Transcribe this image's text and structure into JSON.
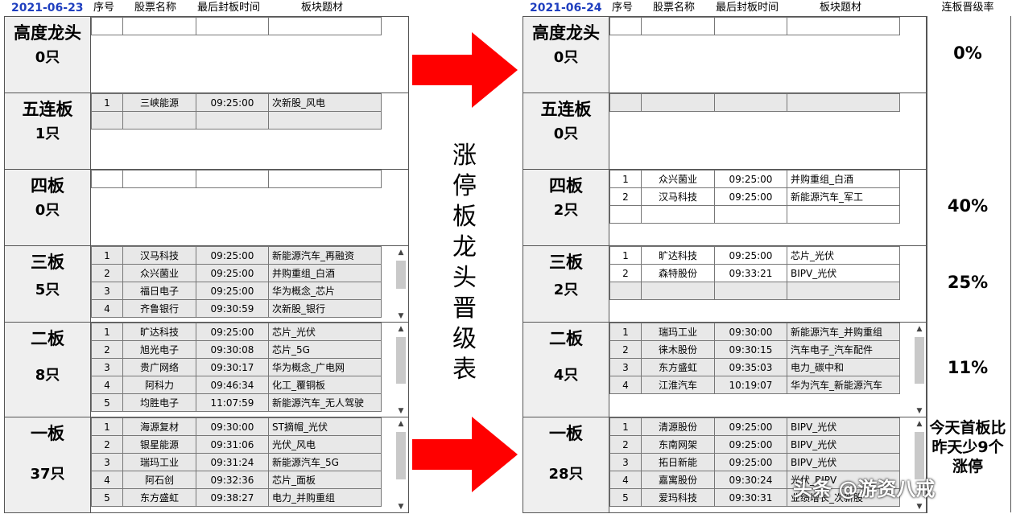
{
  "headers": {
    "left_date": "2021-06-23",
    "right_date": "2021-06-24",
    "col_seq": "序号",
    "col_name": "股票名称",
    "col_time": "最后封板时间",
    "col_theme": "板块题材",
    "col_rate": "连板晋级率"
  },
  "center_title": [
    "涨",
    "停",
    "板",
    "龙",
    "头",
    "晋",
    "级",
    "表"
  ],
  "left": {
    "tiers": [
      {
        "title": "高度龙头",
        "count": "0只",
        "rows": []
      },
      {
        "title": "五连板",
        "count": "1只",
        "rows": [
          [
            "1",
            "三峡能源",
            "09:25:00",
            "次新股_风电"
          ]
        ]
      },
      {
        "title": "四板",
        "count": "0只",
        "rows": []
      },
      {
        "title": "三板",
        "count": "5只",
        "rows": [
          [
            "1",
            "汉马科技",
            "09:25:00",
            "新能源汽车_再融资"
          ],
          [
            "2",
            "众兴菌业",
            "09:25:00",
            "并购重组_白酒"
          ],
          [
            "3",
            "福日电子",
            "09:25:00",
            "华为概念_芯片"
          ],
          [
            "4",
            "齐鲁银行",
            "09:30:59",
            "次新股_银行"
          ]
        ]
      },
      {
        "title": "二板",
        "count": "8只",
        "rows": [
          [
            "1",
            "旷达科技",
            "09:25:00",
            "芯片_光伏"
          ],
          [
            "2",
            "旭光电子",
            "09:30:08",
            "芯片_5G"
          ],
          [
            "3",
            "贵广网络",
            "09:30:17",
            "华为概念_广电网"
          ],
          [
            "4",
            "阿科力",
            "09:46:34",
            "化工_覆铜板"
          ],
          [
            "5",
            "均胜电子",
            "11:07:59",
            "新能源汽车_无人驾驶"
          ]
        ]
      },
      {
        "title": "一板",
        "count": "37只",
        "rows": [
          [
            "1",
            "海源复材",
            "09:30:00",
            "ST摘帽_光伏"
          ],
          [
            "2",
            "银星能源",
            "09:31:06",
            "光伏_风电"
          ],
          [
            "3",
            "瑞玛工业",
            "09:31:24",
            "新能源汽车_5G"
          ],
          [
            "4",
            "阿石创",
            "09:32:36",
            "芯片_面板"
          ],
          [
            "5",
            "东方盛虹",
            "09:38:27",
            "电力_并购重组"
          ]
        ]
      }
    ]
  },
  "right": {
    "tiers": [
      {
        "title": "高度龙头",
        "count": "0只",
        "rate": "0%",
        "rows": []
      },
      {
        "title": "五连板",
        "count": "0只",
        "rate": "",
        "rows": []
      },
      {
        "title": "四板",
        "count": "2只",
        "rate": "40%",
        "rows": [
          [
            "1",
            "众兴菌业",
            "09:25:00",
            "并购重组_白酒"
          ],
          [
            "2",
            "汉马科技",
            "09:25:00",
            "新能源汽车_军工"
          ]
        ]
      },
      {
        "title": "三板",
        "count": "2只",
        "rate": "25%",
        "rows": [
          [
            "1",
            "旷达科技",
            "09:25:00",
            "芯片_光伏"
          ],
          [
            "2",
            "森特股份",
            "09:33:21",
            "BIPV_光伏"
          ]
        ]
      },
      {
        "title": "二板",
        "count": "4只",
        "rate": "11%",
        "rows": [
          [
            "1",
            "瑞玛工业",
            "09:30:00",
            "新能源汽车_并购重组"
          ],
          [
            "2",
            "徕木股份",
            "09:30:15",
            "汽车电子_汽车配件"
          ],
          [
            "3",
            "东方盛虹",
            "09:35:03",
            "电力_碳中和"
          ],
          [
            "4",
            "江淮汽车",
            "10:19:07",
            "华为汽车_新能源汽车"
          ]
        ]
      },
      {
        "title": "一板",
        "count": "28只",
        "rate": "今天首板比昨天少9个涨停",
        "rows": [
          [
            "1",
            "清源股份",
            "09:25:00",
            "BIPV_光伏"
          ],
          [
            "2",
            "东南网架",
            "09:25:00",
            "BIPV_光伏"
          ],
          [
            "3",
            "拓日新能",
            "09:25:00",
            "BIPV_光伏"
          ],
          [
            "4",
            "嘉寓股份",
            "09:30:24",
            "光伏_BIPV"
          ],
          [
            "5",
            "爱玛科技",
            "09:30:31",
            "业绩增长_次新股"
          ]
        ]
      }
    ]
  },
  "watermark": "头条 @游资八戒",
  "colors": {
    "date": "#1f3fbf",
    "arrow": "#ff0000",
    "label_bg": "#efefef",
    "row_bg": "#e8e8e8"
  }
}
